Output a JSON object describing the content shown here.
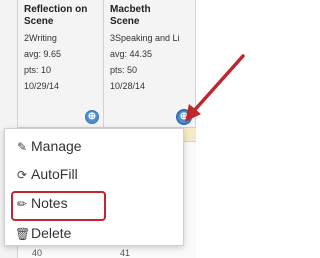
{
  "columns": [
    {
      "title": "Reflection on\nScene",
      "category": "2Writing",
      "avg": "avg: 9.65",
      "pts": "pts: 10",
      "date": "10/29/14"
    },
    {
      "title": "Macbeth\nScene",
      "category": "3Speaking and Li",
      "avg": "avg: 44.35",
      "pts": "pts: 50",
      "date": "10/28/14"
    }
  ],
  "toggle_glyph": "⊕",
  "menu": {
    "items": [
      {
        "label": "Manage",
        "icon": "edit-icon"
      },
      {
        "label": "AutoFill",
        "icon": "refresh-icon"
      },
      {
        "label": "Notes",
        "icon": "pencil-icon"
      },
      {
        "label": "Delete",
        "icon": "trash-icon"
      }
    ]
  },
  "bottom_cells": [
    "40",
    "41"
  ],
  "colors": {
    "accent": "#4a8fd0",
    "annotation": "#c0262d",
    "highlight_strip": "#f6e9c8"
  }
}
